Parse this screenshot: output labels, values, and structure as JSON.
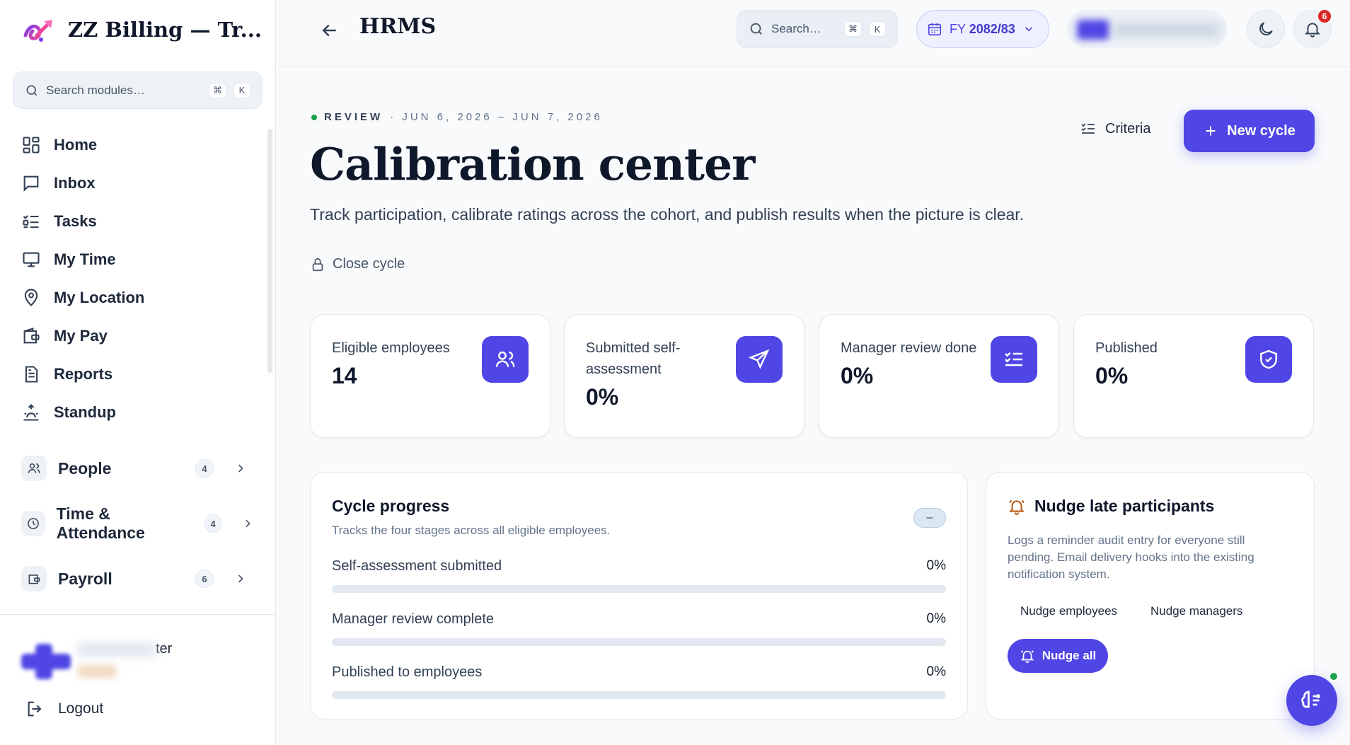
{
  "brand": {
    "name": "ZZ Billing — Tr..."
  },
  "sidebar": {
    "search_placeholder": "Search modules…",
    "kbd1": "⌘",
    "kbd2": "K",
    "items": [
      {
        "label": "Home",
        "icon": "grid-icon"
      },
      {
        "label": "Inbox",
        "icon": "message-icon"
      },
      {
        "label": "Tasks",
        "icon": "checklist-icon"
      },
      {
        "label": "My Time",
        "icon": "monitor-icon"
      },
      {
        "label": "My Location",
        "icon": "map-pin-icon"
      },
      {
        "label": "My Pay",
        "icon": "wallet-icon"
      },
      {
        "label": "Reports",
        "icon": "document-icon"
      },
      {
        "label": "Standup",
        "icon": "sunrise-icon"
      }
    ],
    "groups": [
      {
        "label": "People",
        "count": "4",
        "icon": "users-icon"
      },
      {
        "label": "Time & Attendance",
        "count": "4",
        "icon": "clock-icon"
      },
      {
        "label": "Payroll",
        "count": "6",
        "icon": "wallet-icon"
      }
    ],
    "user_name_suffix": "ter",
    "logout": "Logout"
  },
  "header": {
    "title": "HRMS",
    "search_placeholder": "Search…",
    "kbd1": "⌘",
    "kbd2": "K",
    "fy_label": "FY",
    "fy_value": "2082/83",
    "notifications": "6"
  },
  "page": {
    "eyebrow_tag": "REVIEW",
    "eyebrow_dates": "· JUN 6, 2026 – JUN 7, 2026",
    "title": "Calibration center",
    "subtitle": "Track participation, calibrate ratings across the cohort, and publish results when the picture is clear.",
    "close_cycle": "Close cycle",
    "criteria": "Criteria",
    "new_cycle": "New cycle"
  },
  "stats": [
    {
      "label": "Eligible employees",
      "value": "14",
      "icon": "users-icon"
    },
    {
      "label": "Submitted self-assessment",
      "value": "0%",
      "icon": "send-icon"
    },
    {
      "label": "Manager review done",
      "value": "0%",
      "icon": "list-check-icon"
    },
    {
      "label": "Published",
      "value": "0%",
      "icon": "shield-check-icon"
    }
  ],
  "progress": {
    "title": "Cycle progress",
    "subtitle": "Tracks the four stages across all eligible employees.",
    "pill": "–",
    "rows": [
      {
        "label": "Self-assessment submitted",
        "value": "0%",
        "fraction": 0
      },
      {
        "label": "Manager review complete",
        "value": "0%",
        "fraction": 0
      },
      {
        "label": "Published to employees",
        "value": "0%",
        "fraction": 0
      }
    ]
  },
  "nudge": {
    "title": "Nudge late participants",
    "description": "Logs a reminder audit entry for everyone still pending. Email delivery hooks into the existing notification system.",
    "employees": "Nudge employees",
    "managers": "Nudge managers",
    "all": "Nudge all"
  },
  "colors": {
    "accent": "#4f46e5",
    "bg": "#f8fafc",
    "danger": "#dc2626",
    "online": "#16a34a"
  }
}
